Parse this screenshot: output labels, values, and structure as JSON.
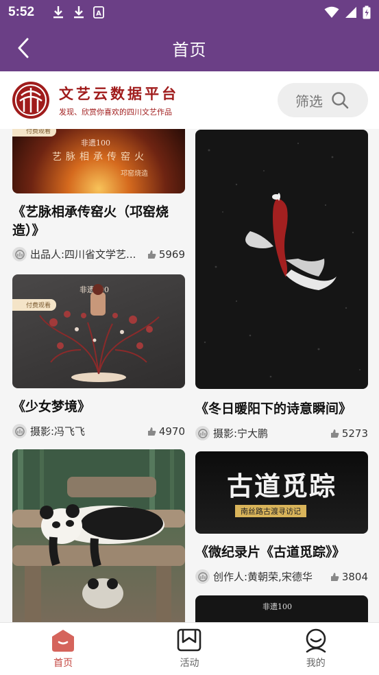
{
  "status_bar": {
    "time": "5:52"
  },
  "header": {
    "title": "首页"
  },
  "brand": {
    "name": "文艺云数据平台",
    "slogan": "发现、欣赏你喜欢的四川文艺作品",
    "filter_label": "筛选"
  },
  "paid_badge": "付费观看",
  "feed": {
    "left": [
      {
        "title_line1": "《艺脉相承传窑火（邛窑烧",
        "title_line2": "造）》",
        "author": "出品人:四川省文学艺...",
        "likes": "5969",
        "image_text": "艺脉相承传窑火",
        "image_subtext": "邛窑烧造",
        "image_logo": "非遗100"
      },
      {
        "title_line1": "《少女梦境》",
        "author": "摄影:冯飞飞",
        "likes": "4970",
        "image_logo": "非遗100"
      },
      {
        "title_line1": "",
        "author": "",
        "likes": ""
      }
    ],
    "right": [
      {
        "title_line1": "《冬日暖阳下的诗意瞬间》",
        "author": "摄影:宁大鹏",
        "likes": "5273"
      },
      {
        "title_line1": "《微纪录片《古道觅踪》》",
        "author": "创作人:黄朝荣,宋德华",
        "likes": "3804",
        "image_text": "古道觅踪",
        "image_subtext": "南丝路古渡寻访记"
      },
      {
        "image_logo": "非遗100"
      }
    ]
  },
  "nav": {
    "home": "首页",
    "activity": "活动",
    "mine": "我的"
  },
  "colors": {
    "brand_purple": "#6b3f86",
    "brand_red": "#a01c1c",
    "nav_active": "#c4453f"
  }
}
